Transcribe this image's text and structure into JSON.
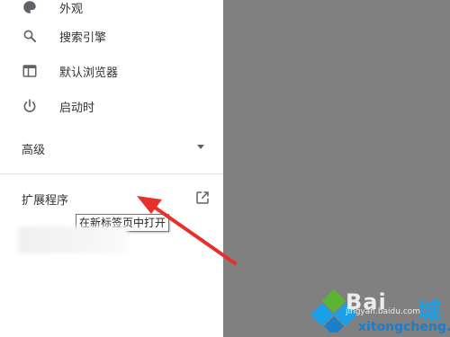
{
  "sidebar": {
    "items": [
      {
        "label": "外观",
        "icon": "palette-icon"
      },
      {
        "label": "搜索引擎",
        "icon": "search-icon"
      },
      {
        "label": "默认浏览器",
        "icon": "browser-window-icon"
      },
      {
        "label": "启动时",
        "icon": "power-icon"
      }
    ],
    "advanced_label": "高级",
    "extensions_label": "扩展程序",
    "extensions_icon": "open-in-new-tab-icon"
  },
  "tooltip": {
    "text": "在新标签页中打开"
  },
  "annotation": {
    "arrow_color": "#e8302a"
  },
  "watermark": {
    "brand": "Bai",
    "sub": "jingyan.baidu.com",
    "char": "城",
    "domain": "xitongcheng.com"
  },
  "colors": {
    "overlay": "#808080",
    "text": "#333333",
    "icon": "#5f6368"
  }
}
